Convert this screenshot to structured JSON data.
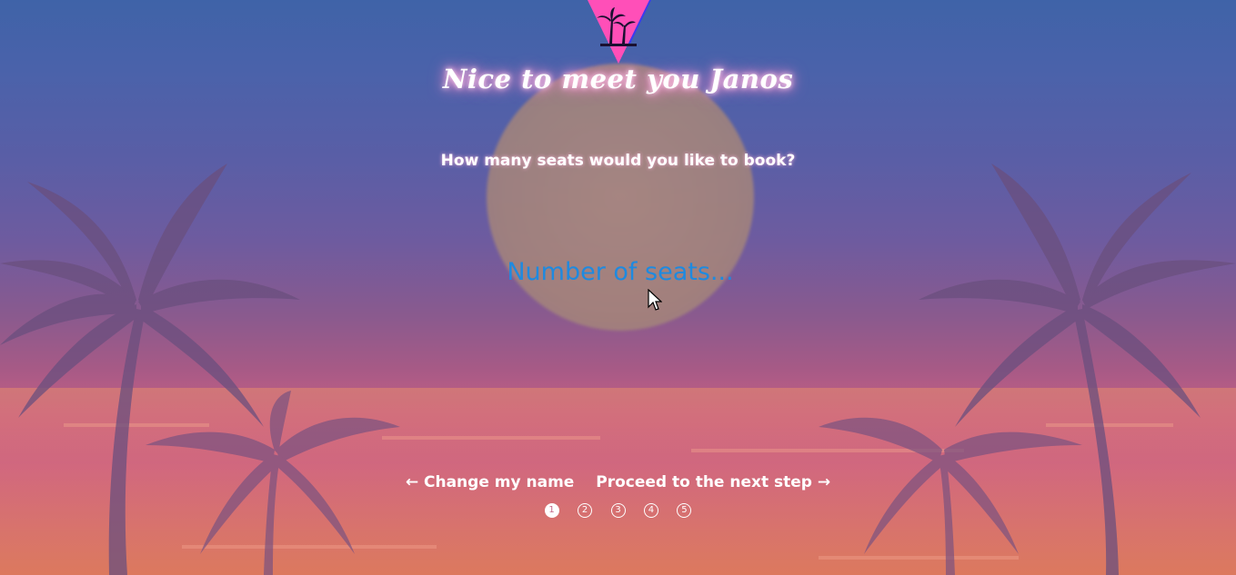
{
  "header": {
    "logo_icon": "palm-triangle-logo-icon",
    "title": "Nice to meet you Janos"
  },
  "form": {
    "question": "How many seats would you like to book?",
    "seats_placeholder": "Number of seats...",
    "seats_value": ""
  },
  "navigation": {
    "back_label": "← Change my name",
    "next_label": "Proceed to the next step →"
  },
  "steps": {
    "items": [
      "1",
      "2",
      "3",
      "4",
      "5"
    ],
    "current": 1
  },
  "colors": {
    "accent_input": "#1e88e5",
    "title_glow": "#ff7cc8",
    "logo_pink": "#ff4fb8"
  }
}
